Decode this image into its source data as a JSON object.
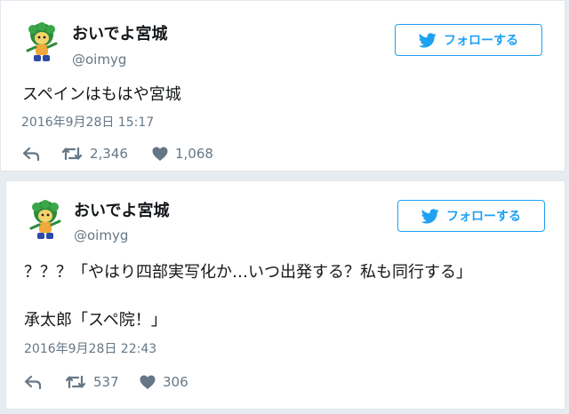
{
  "tweets": [
    {
      "author_name": "おいでよ宮城",
      "handle": "@oimyg",
      "follow_label": "フォローする",
      "text_lines": [
        "スペインはもはや宮城"
      ],
      "timestamp": "2016年9月28日 15:17",
      "retweets": "2,346",
      "likes": "1,068"
    },
    {
      "author_name": "おいでよ宮城",
      "handle": "@oimyg",
      "follow_label": "フォローする",
      "text_lines": [
        "？？？「やはり四部実写化か…いつ出発する？私も同行する」",
        "承太郎「スペ院！」"
      ],
      "timestamp": "2016年9月28日 22:43",
      "retweets": "537",
      "likes": "306"
    }
  ],
  "colors": {
    "accent": "#1da1f2",
    "muted": "#657786",
    "background": "#e6ecf0"
  },
  "icons": [
    "mascot-avatar",
    "twitter-bird-icon",
    "reply-icon",
    "retweet-icon",
    "like-icon"
  ]
}
